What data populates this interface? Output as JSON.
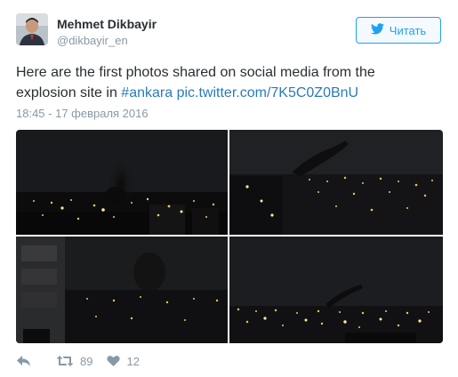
{
  "author": {
    "name": "Mehmet Dikbayir",
    "handle": "@dikbayir_en"
  },
  "follow_button": {
    "label": "Читать",
    "icon": "twitter-bird-icon"
  },
  "tweet": {
    "text_before": "Here are the first photos shared on social media from the explosion site in ",
    "hashtag": "#ankara",
    "link": "pic.twitter.com/7K5C0Z0BnU",
    "timestamp": "18:45 - 17 февраля 2016"
  },
  "actions": {
    "reply_icon": "reply-icon",
    "retweet_icon": "retweet-icon",
    "retweet_count": "89",
    "like_icon": "heart-icon",
    "like_count": "12"
  },
  "colors": {
    "accent": "#1da1f2",
    "link": "#2b7bb9",
    "secondary_text": "#8899a6"
  }
}
